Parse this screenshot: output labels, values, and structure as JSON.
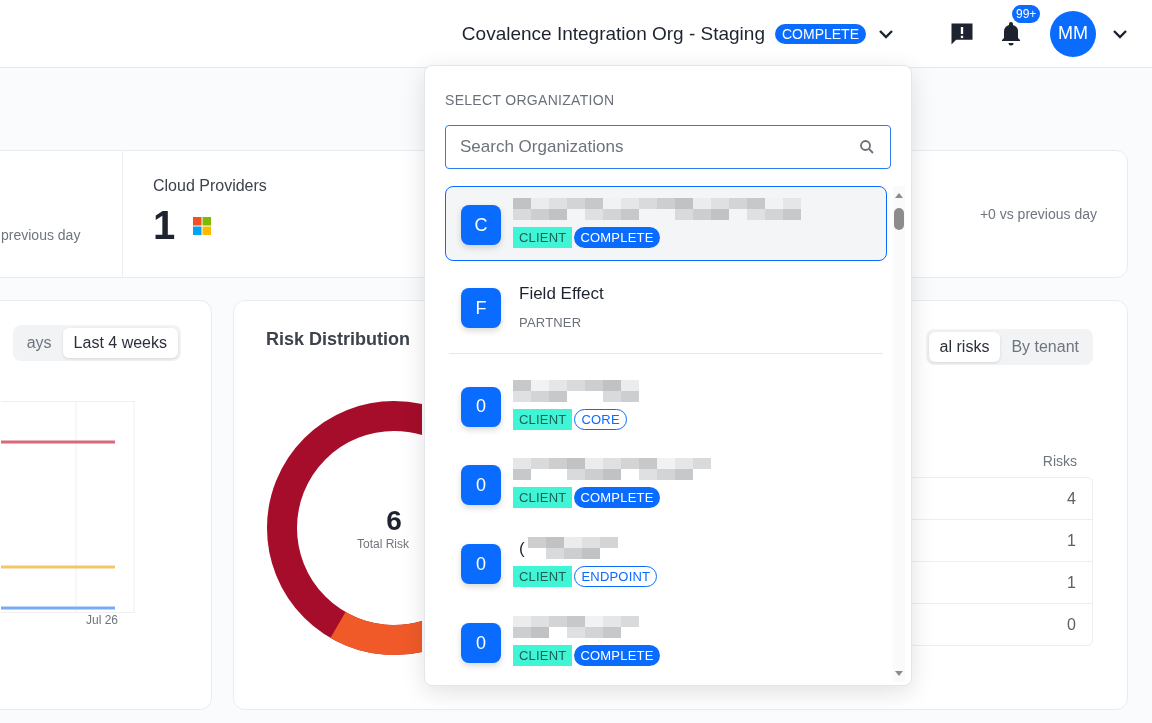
{
  "header": {
    "org_name": "Covalence Integration Org - Staging",
    "org_status": "COMPLETE",
    "notification_count": "99+",
    "avatar_initials": "MM"
  },
  "dashboard": {
    "stat_card": {
      "left_note": "previous day",
      "cloud_title": "Cloud Providers",
      "cloud_count": "1",
      "right_note": "+0 vs previous day"
    },
    "trend_card": {
      "ranges": [
        {
          "label": "ays",
          "selected": false
        },
        {
          "label": "Last 4 weeks",
          "selected": true
        }
      ],
      "x_label": "Jul 26"
    },
    "risk_card": {
      "title": "Risk Distribution",
      "total": "6",
      "total_label": "Total Risk",
      "views": [
        {
          "label": "al risks",
          "selected": true
        },
        {
          "label": "By tenant",
          "selected": false
        }
      ],
      "column_header": "Risks",
      "rows": [
        "4",
        "1",
        "1",
        "0"
      ]
    }
  },
  "org_dropdown": {
    "title": "SELECT ORGANIZATION",
    "search": {
      "placeholder": "Search Organizations"
    },
    "items": [
      {
        "initial": "C",
        "redacted": true,
        "selected": true,
        "tags": [
          {
            "label": "CLIENT",
            "kind": "highlight"
          },
          {
            "label": "COMPLETE",
            "kind": "filled"
          }
        ]
      },
      {
        "initial": "F",
        "name": "Field Effect",
        "redacted": false,
        "selected": false,
        "tags": [
          {
            "label": "PARTNER",
            "kind": "plain"
          }
        ]
      },
      {
        "initial": "0",
        "redacted": true,
        "selected": false,
        "tags": [
          {
            "label": "CLIENT",
            "kind": "highlight"
          },
          {
            "label": "CORE",
            "kind": "outline"
          }
        ]
      },
      {
        "initial": "0",
        "redacted": true,
        "selected": false,
        "tags": [
          {
            "label": "CLIENT",
            "kind": "highlight"
          },
          {
            "label": "COMPLETE",
            "kind": "filled"
          }
        ]
      },
      {
        "initial": "0",
        "name": "(",
        "redacted": true,
        "selected": false,
        "tags": [
          {
            "label": "CLIENT",
            "kind": "highlight"
          },
          {
            "label": "ENDPOINT",
            "kind": "outline"
          }
        ]
      },
      {
        "initial": "0",
        "redacted": true,
        "selected": false,
        "tags": [
          {
            "label": "CLIENT",
            "kind": "highlight"
          },
          {
            "label": "COMPLETE",
            "kind": "filled"
          }
        ]
      }
    ]
  }
}
